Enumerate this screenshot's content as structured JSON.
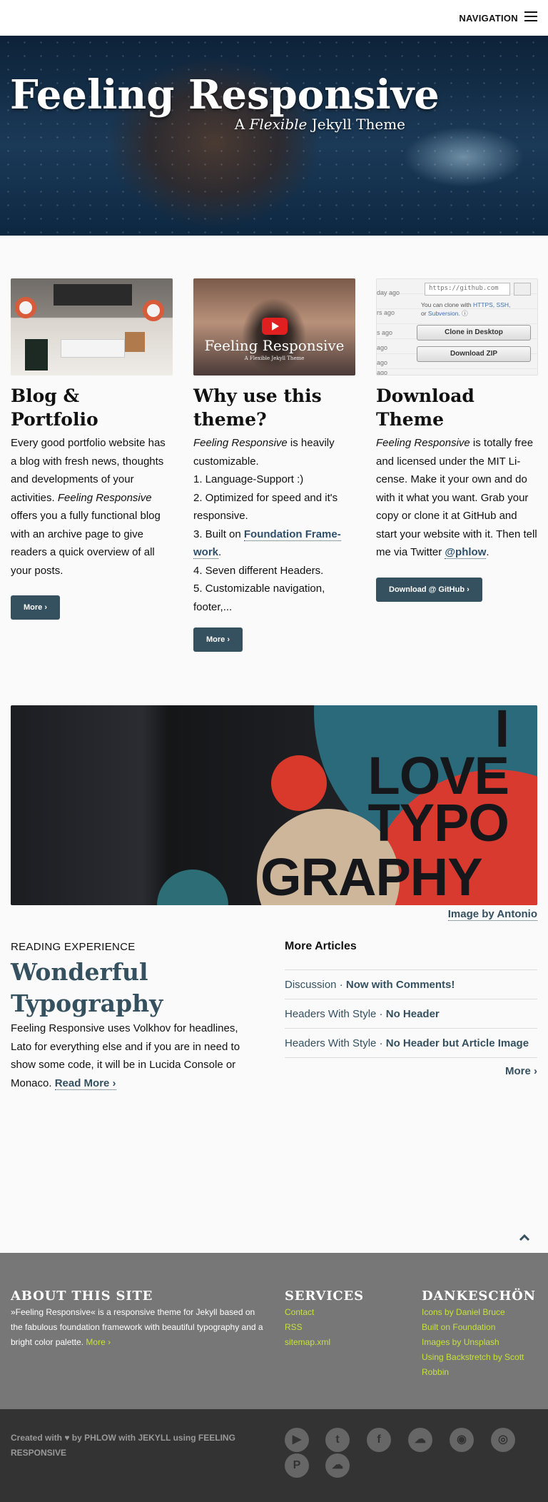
{
  "nav": {
    "label": "NAVIGATION"
  },
  "hero": {
    "title": "Feeling Responsive",
    "sub_pre": "A ",
    "sub_em": "Flexible",
    "sub_post": " Jekyll Theme"
  },
  "features": [
    {
      "title": "Blog & Portfolio",
      "text_1": "Every good portfolio website has a blog with fresh news, thoughts and developments of your activities. ",
      "text_em": "Feeling Respon­sive",
      "text_2": " offers you a fully functional blog with an archive page to give readers a quick overview of all your posts.",
      "button": "More ›"
    },
    {
      "title": "Why use this theme?",
      "intro_em": "Feeling Responsive",
      "intro": " is heavily cus­tomizable.",
      "items": [
        "1. Language-Support :)",
        "2. Optimized for speed and it's responsive.",
        "3. Built on ",
        "4. Seven different Headers.",
        "5. Customizable navigation, footer,..."
      ],
      "item3_link": "Foundation Frame­work",
      "item3_end": ".",
      "video_title": "Feeling Responsive",
      "video_sub": "A Flexible Jekyll Theme",
      "button": "More ›"
    },
    {
      "title": "Download Theme",
      "text_em": "Feeling Responsive",
      "text_1": " is totally free and licensed under the MIT Li­cense. Make it your own and do with it what you want. Grab your copy or clone it at GitHub and start your website with it. Then tell me via Twitter ",
      "link": "@phlow",
      "text_2": ".",
      "gh_url": "https://github.com",
      "gh_info_1": "You can clone with ",
      "gh_info_links": "HTTPS, SSH,",
      "gh_info_2": "or ",
      "gh_info_sub": "Subversion.",
      "gh_clone": "Clone in Desktop",
      "gh_zip": "Download ZIP",
      "gh_ages": [
        "day ago",
        "rs ago",
        "s ago",
        "ago",
        "ago",
        "ago"
      ],
      "button": "Download @ GitHub ›"
    }
  ],
  "banner": {
    "words": [
      "I",
      "LOVE",
      "TYPO"
    ],
    "last": "GRAPHY",
    "credit": "Image by Antonio"
  },
  "article": {
    "eyebrow": "READING EXPERIENCE",
    "title": "Wonderful Typography",
    "body": "Feeling Responsive uses Volkhov for headlines, Lato for everything else and if you are in need to show some code, it will be in Lucida Console or Monaco. ",
    "read_more": "Read More ›"
  },
  "more_articles": {
    "heading": "More Articles",
    "items": [
      {
        "category": "Discussion",
        "title": "Now with Comments!"
      },
      {
        "category": "Headers With Style",
        "title": "No Header"
      },
      {
        "category": "Headers With Style",
        "title": "No Header but Article Image"
      }
    ],
    "more": "More ›"
  },
  "footer": {
    "about_title": "ABOUT THIS SITE",
    "about_text": "»Feeling Responsive« is a responsive theme for Jekyll based on the fabulous foundation framework with beautiful typography and a bright color palette. ",
    "about_more": "More ›",
    "services_title": "SERVICES",
    "services": [
      "Contact",
      "RSS",
      "sitemap.xml"
    ],
    "thanks_title": "DANKESCHÖN",
    "thanks": [
      "Icons by Daniel Bruce",
      "Built on Foundation",
      "Images by Unsplash",
      "Using Backstretch by Scott Robbin"
    ],
    "credits": "Created with ♥ by PHLOW with JEKYLL using FEELING RESPONSIVE",
    "social_icons": [
      "youtube-icon",
      "twitter-icon",
      "facebook-icon",
      "soundcloud-icon",
      "github-icon",
      "instagram-icon",
      "pinterest-icon",
      "cloud-icon"
    ]
  },
  "colors": {
    "accent": "#35505f",
    "footer_link": "#c6e13f",
    "footer_bg": "#777777",
    "subfooter_bg": "#333333"
  }
}
